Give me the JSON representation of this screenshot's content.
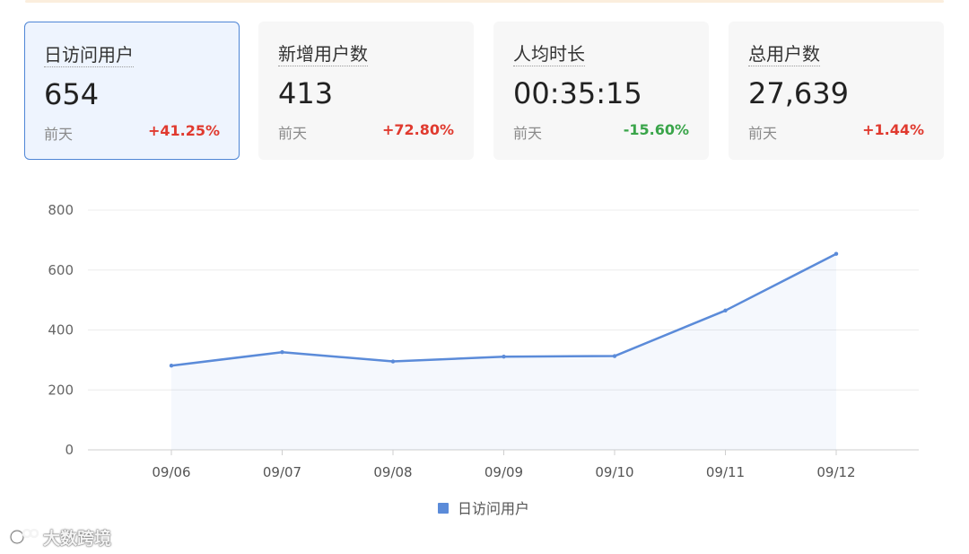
{
  "cards": [
    {
      "title": "日访问用户",
      "value": "654",
      "period": "前天",
      "change": "+41.25%",
      "change_color": "#e03a2f"
    },
    {
      "title": "新增用户数",
      "value": "413",
      "period": "前天",
      "change": "+72.80%",
      "change_color": "#e03a2f"
    },
    {
      "title": "人均时长",
      "value": "00:35:15",
      "period": "前天",
      "change": "-15.60%",
      "change_color": "#3aa54a"
    },
    {
      "title": "总用户数",
      "value": "27,639",
      "period": "前天",
      "change": "+1.44%",
      "change_color": "#e03a2f"
    }
  ],
  "chart_data": {
    "type": "area",
    "categories": [
      "09/06",
      "09/07",
      "09/08",
      "09/09",
      "09/10",
      "09/11",
      "09/12"
    ],
    "series": [
      {
        "name": "日访问用户",
        "values": [
          281,
          326,
          295,
          311,
          313,
          465,
          654
        ],
        "color": "#5b8bd9"
      }
    ],
    "ylim": [
      0,
      800
    ],
    "yticks": [
      0,
      200,
      400,
      600,
      800
    ],
    "grid": true,
    "legend_position": "bottom-center"
  },
  "watermark": {
    "text": "大数跨境",
    "icon": "logo-icon"
  },
  "colors": {
    "accent": "#4f86d6",
    "up": "#e03a2f",
    "down": "#3aa54a"
  }
}
